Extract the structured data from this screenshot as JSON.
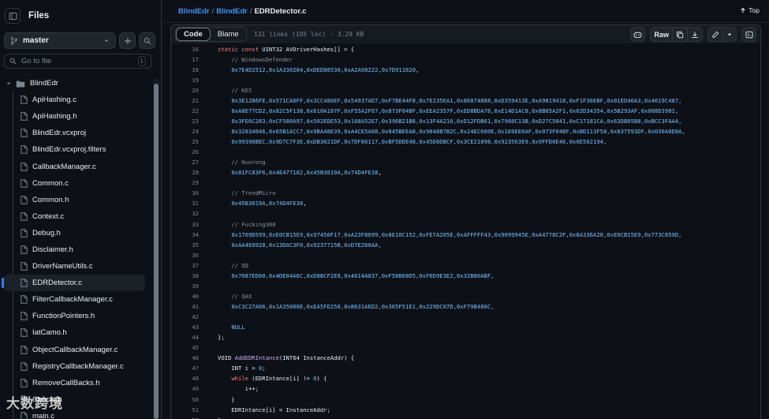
{
  "sidebar": {
    "title": "Files",
    "branch": "master",
    "goto_placeholder": "Go to file",
    "goto_shortcut": "t",
    "root_folder": "BlindEdr",
    "files": [
      "ApiHashing.c",
      "ApiHashing.h",
      "BlindEdr.vcxproj",
      "BlindEdr.vcxproj.filters",
      "CallbackManager.c",
      "Common.c",
      "Common.h",
      "Context.c",
      "Debug.h",
      "Disclaimer.h",
      "DriverNameUtils.c",
      "EDRDetector.c",
      "FilterCallbackManager.c",
      "FunctionPointers.h",
      "IatCamo.h",
      "ObjectCallbackManager.c",
      "RegistryCallbackManager.c",
      "RemoveCallBacks.h",
      "Structs.h",
      "main.c"
    ],
    "active_file": "EDRDetector.c"
  },
  "breadcrumb": {
    "repo": "BlindEdr",
    "folder": "BlindEdr",
    "file": "EDRDetector.c",
    "sep": "/"
  },
  "top_link": "Top",
  "toolbar": {
    "tab_code": "Code",
    "tab_blame": "Blame",
    "meta": "131 lines (105 loc) · 3.29 KB",
    "raw_label": "Raw"
  },
  "code_lines": [
    {
      "n": "16",
      "html": "<span class=\"kw\">static const</span> UINT32 AVDriverHashes[] = {"
    },
    {
      "n": "17",
      "html": "    <span class=\"cm\">// WindowsDefender</span>"
    },
    {
      "n": "18",
      "html": "    <span class=\"num\">0x7E4D2512</span>,<span class=\"num\">0x1A330284</span>,<span class=\"num\">0xDED88530</span>,<span class=\"num\">0xA2A98222</span>,<span class=\"num\">0x7D911820</span>,"
    },
    {
      "n": "19",
      "html": ""
    },
    {
      "n": "20",
      "html": "    <span class=\"cm\">// KES</span>"
    },
    {
      "n": "21",
      "html": "    <span class=\"num\">0x3E12B6FE,0x571CA6FF,0x3CC480EF,0x54937AD7,0xF7BE44F8,0x7E235EA1,0x86874888,0xD359413E,0xA9819418,0xF1F36EBF,0x01ED40A3,0x4619C487,</span>"
    },
    {
      "n": "22",
      "html": "    <span class=\"num\">0xA8E77CD2,0x82C5F138,0x610A107F,0xF55A2F67,0x873F04BF,0xEEA2357F,0xED8BDA78,0xE14D1AC8,0x8B05A2F1,0x62D34354,0x5B293AF,0x088D3981,</span>"
    },
    {
      "n": "23",
      "html": "    <span class=\"num\">0x3FE6C283,0xCF580A97,0x502EDE53,0x168A52E7,0x396B21B8,0x13F4A216,0xD12FDB61,0x7960C13B,0xD27C5841,0xC17181CA,0x63DB05B8,0xBCC3FAA4,</span>"
    },
    {
      "n": "24",
      "html": "    <span class=\"num\">0x32834046,0x65B1ACC7,0x9BA48E39,0xA4CE5A08,0x845BEEA8,0x9848B7B2C,0x24EC600E,0x1E6EE6AF,0x073F04BF,0xBD113F58,0x837593DF,0x030A0D8A,</span>"
    },
    {
      "n": "25",
      "html": "    <span class=\"num\">0x99396BEC,0x9D7C7F3E,0xDB3021DF,0x7DF86117,0xBF5DDE48,0x45D6DBCF,0x3CE21898,0x923563E9,0x9FFD0E46,0x0E562194,</span>"
    },
    {
      "n": "26",
      "html": ""
    },
    {
      "n": "27",
      "html": "    <span class=\"cm\">// Huorong</span>"
    },
    {
      "n": "28",
      "html": "    <span class=\"num\">0x81FC83F6</span>,<span class=\"num\">0x4E477102</span>,<span class=\"num\">0x45B3019A</span>,<span class=\"num\">0x74D4FE38</span>,"
    },
    {
      "n": "29",
      "html": ""
    },
    {
      "n": "30",
      "html": "    <span class=\"cm\">// TrendMicro</span>"
    },
    {
      "n": "31",
      "html": "    <span class=\"num\">0x45B3019A</span>,<span class=\"num\">0x74D4FE38</span>,"
    },
    {
      "n": "32",
      "html": ""
    },
    {
      "n": "33",
      "html": "    <span class=\"cm\">// Fucking360</span>"
    },
    {
      "n": "34",
      "html": "    <span class=\"num\">0x1769D599,0xE0CB15E9,0x97450F17,0xA23F8699,0x8E10C152,0xFE7A205E,0xAFFFFF43,0x9099945E,0xA4778C2F,0x8A336A20,0xE0CB15E9,0x773C859D,</span>"
    },
    {
      "n": "35",
      "html": "    <span class=\"num\">0xAA4E0928,0x13DAC3F0,0x9237715B,0xD7E260AA,</span>"
    },
    {
      "n": "36",
      "html": ""
    },
    {
      "n": "37",
      "html": "    <span class=\"cm\">// QQ</span>"
    },
    {
      "n": "38",
      "html": "    <span class=\"num\">0x7087ED00,0x4DE04A6C,0xD8BCF2E8,0x4614A037,0xF58B68D5,0xF6D9E3E2,0x32B80ABF,</span>"
    },
    {
      "n": "39",
      "html": ""
    },
    {
      "n": "40",
      "html": "    <span class=\"cm\">// QAX</span>"
    },
    {
      "n": "41",
      "html": "    <span class=\"num\">0xC3C27A06,0x1A35000E,0xEA5FD256,0x8631AED2,0x365F51E1,0x229DC07D,0xF79B480C,</span>"
    },
    {
      "n": "42",
      "html": ""
    },
    {
      "n": "43",
      "html": "    <span class=\"num\">NULL</span>"
    },
    {
      "n": "44",
      "html": "};"
    },
    {
      "n": "45",
      "html": ""
    },
    {
      "n": "46",
      "html": "VOID <span class=\"fn\">AddEDRIntance</span>(INT64 InstanceAddr) {"
    },
    {
      "n": "47",
      "html": "    INT i = <span class=\"num\">0</span>;"
    },
    {
      "n": "48",
      "html": "    <span class=\"kw\">while</span> (EDRIntance[i] != <span class=\"num\">0</span>) {"
    },
    {
      "n": "49",
      "html": "        i++;"
    },
    {
      "n": "50",
      "html": "    }"
    },
    {
      "n": "51",
      "html": "    EDRIntance[i] = InstanceAddr;"
    },
    {
      "n": "52",
      "html": "}"
    }
  ],
  "watermark": "大数跨境"
}
